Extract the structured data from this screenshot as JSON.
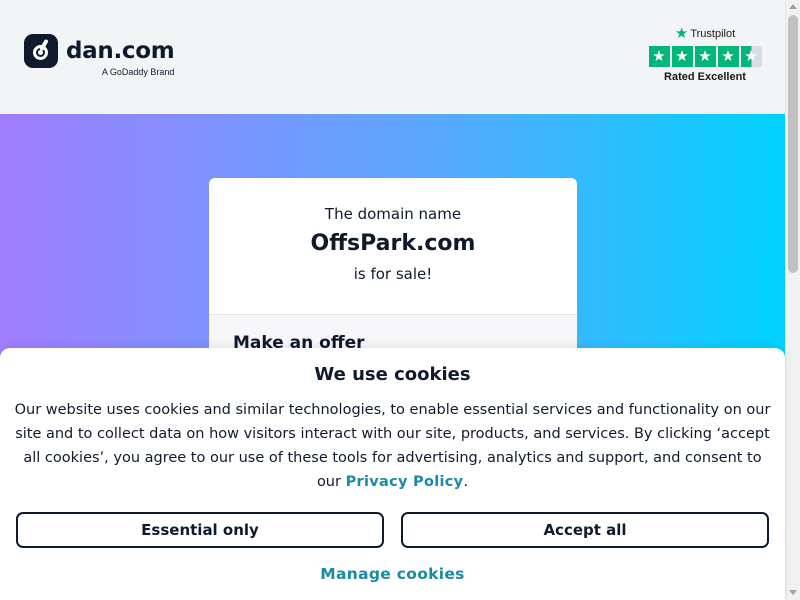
{
  "header": {
    "brand_name": "dan.com",
    "brand_tagline": "A GoDaddy Brand",
    "trustpilot": {
      "label": "Trustpilot",
      "rating_text": "Rated Excellent",
      "stars": 4.5
    }
  },
  "card": {
    "intro": "The domain name",
    "domain": "OffsPark.com",
    "sale_text": "is for sale!",
    "offer_heading": "Make an offer"
  },
  "cookie_banner": {
    "title": "We use cookies",
    "body": "Our website uses cookies and similar technologies, to enable essential services and functionality on our site and to collect data on how visitors interact with our site, products, and services. By clicking ‘accept all cookies’, you agree to our use of these tools for advertising, analytics and support, and consent to our",
    "privacy_link": "Privacy Policy",
    "period": ".",
    "essential_button": "Essential only",
    "accept_button": "Accept all",
    "manage_link": "Manage cookies"
  },
  "colors": {
    "brand_dark": "#0f1b2d",
    "trustpilot_green": "#00b67a",
    "link_teal": "#1a8aa6",
    "hero_gradient_start": "#a07dff",
    "hero_gradient_end": "#00d2ff"
  }
}
